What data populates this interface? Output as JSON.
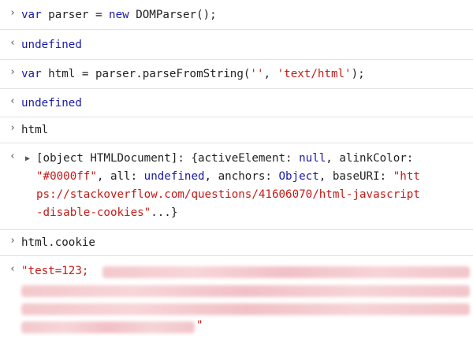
{
  "console": {
    "entries": [
      {
        "type": "input",
        "parts": [
          {
            "cls": "kw",
            "text": "var"
          },
          {
            "cls": "plain",
            "text": " parser = "
          },
          {
            "cls": "kw",
            "text": "new"
          },
          {
            "cls": "plain",
            "text": " DOMParser();"
          }
        ]
      },
      {
        "type": "output",
        "text": "undefined"
      },
      {
        "type": "input",
        "parts": [
          {
            "cls": "kw",
            "text": "var"
          },
          {
            "cls": "plain",
            "text": " html = parser.parseFromString("
          },
          {
            "cls": "str",
            "text": "''"
          },
          {
            "cls": "plain",
            "text": ", "
          },
          {
            "cls": "str",
            "text": "'text/html'"
          },
          {
            "cls": "plain",
            "text": ");"
          }
        ]
      },
      {
        "type": "output",
        "text": "undefined"
      },
      {
        "type": "input",
        "text": "html"
      },
      {
        "type": "object",
        "lines": [
          [
            {
              "cls": "plain",
              "text": "[object HTMLDocument]: {activeElement: "
            },
            {
              "cls": "kw",
              "text": "null"
            },
            {
              "cls": "plain",
              "text": ", alinkColor:"
            }
          ],
          [
            {
              "cls": "str",
              "text": "\"#0000ff\""
            },
            {
              "cls": "plain",
              "text": ", all: "
            },
            {
              "cls": "kw",
              "text": "undefined"
            },
            {
              "cls": "plain",
              "text": ", anchors: "
            },
            {
              "cls": "kw",
              "text": "Object"
            },
            {
              "cls": "plain",
              "text": ", baseURI: "
            },
            {
              "cls": "str",
              "text": "\"htt"
            }
          ],
          [
            {
              "cls": "str",
              "text": "ps://stackoverflow.com/questions/41606070/html-javascript"
            }
          ],
          [
            {
              "cls": "str",
              "text": "-disable-cookies\""
            },
            {
              "cls": "plain",
              "text": "...}"
            }
          ]
        ]
      },
      {
        "type": "input",
        "text": "html.cookie"
      },
      {
        "type": "output-string",
        "prefix": "\"test=123;",
        "suffix": "\""
      }
    ]
  }
}
